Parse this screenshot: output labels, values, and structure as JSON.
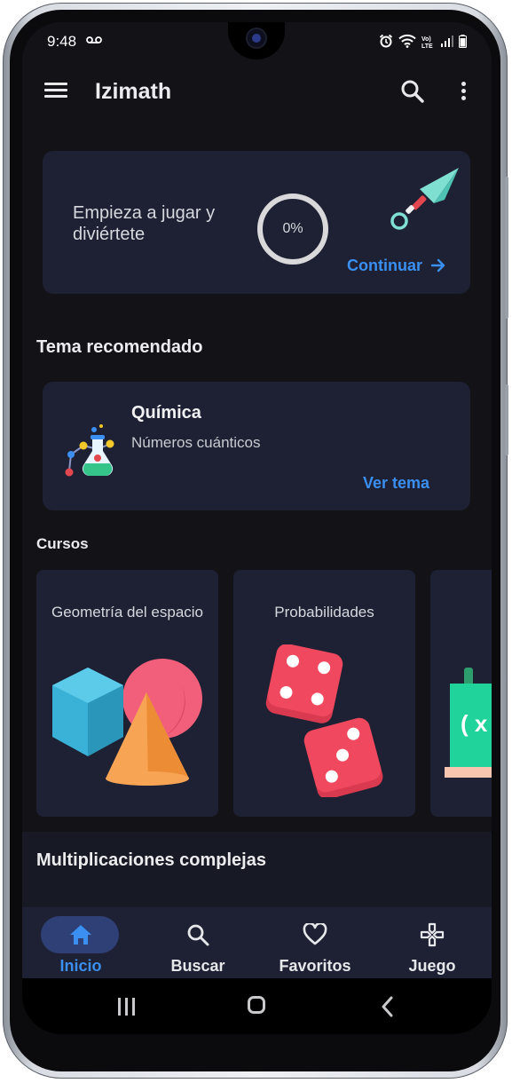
{
  "status_bar": {
    "time": "9:48",
    "voicemail_icon": "voicemail-icon",
    "network_label": "Vo) LTE"
  },
  "app_bar": {
    "title": "Izimath"
  },
  "progress_card": {
    "text": "Empieza a jugar y diviértete",
    "progress_label": "0%",
    "progress_value": 0,
    "action_label": "Continuar"
  },
  "recommended": {
    "section_title": "Tema recomendado",
    "topic_title": "Química",
    "topic_subtitle": "Números cuánticos",
    "action_label": "Ver tema"
  },
  "courses": {
    "section_title": "Cursos",
    "items": [
      {
        "title": "Geometría del espacio",
        "icon": "geometry-shapes-icon"
      },
      {
        "title": "Probabilidades",
        "icon": "dice-icon"
      },
      {
        "title": "",
        "icon": "chalkboard-icon"
      }
    ],
    "partial_card_text": "( x"
  },
  "multiplications": {
    "section_title": "Multiplicaciones complejas"
  },
  "bottom_nav": {
    "items": [
      {
        "label": "Inicio",
        "icon": "home-icon",
        "active": true
      },
      {
        "label": "Buscar",
        "icon": "search-icon",
        "active": false
      },
      {
        "label": "Favoritos",
        "icon": "heart-icon",
        "active": false
      },
      {
        "label": "Juego",
        "icon": "gamepad-icon",
        "active": false
      }
    ]
  },
  "colors": {
    "accent": "#3a8ff0",
    "background": "#121217",
    "card": "#1d2133",
    "nav_active_pill": "#2e4076"
  }
}
